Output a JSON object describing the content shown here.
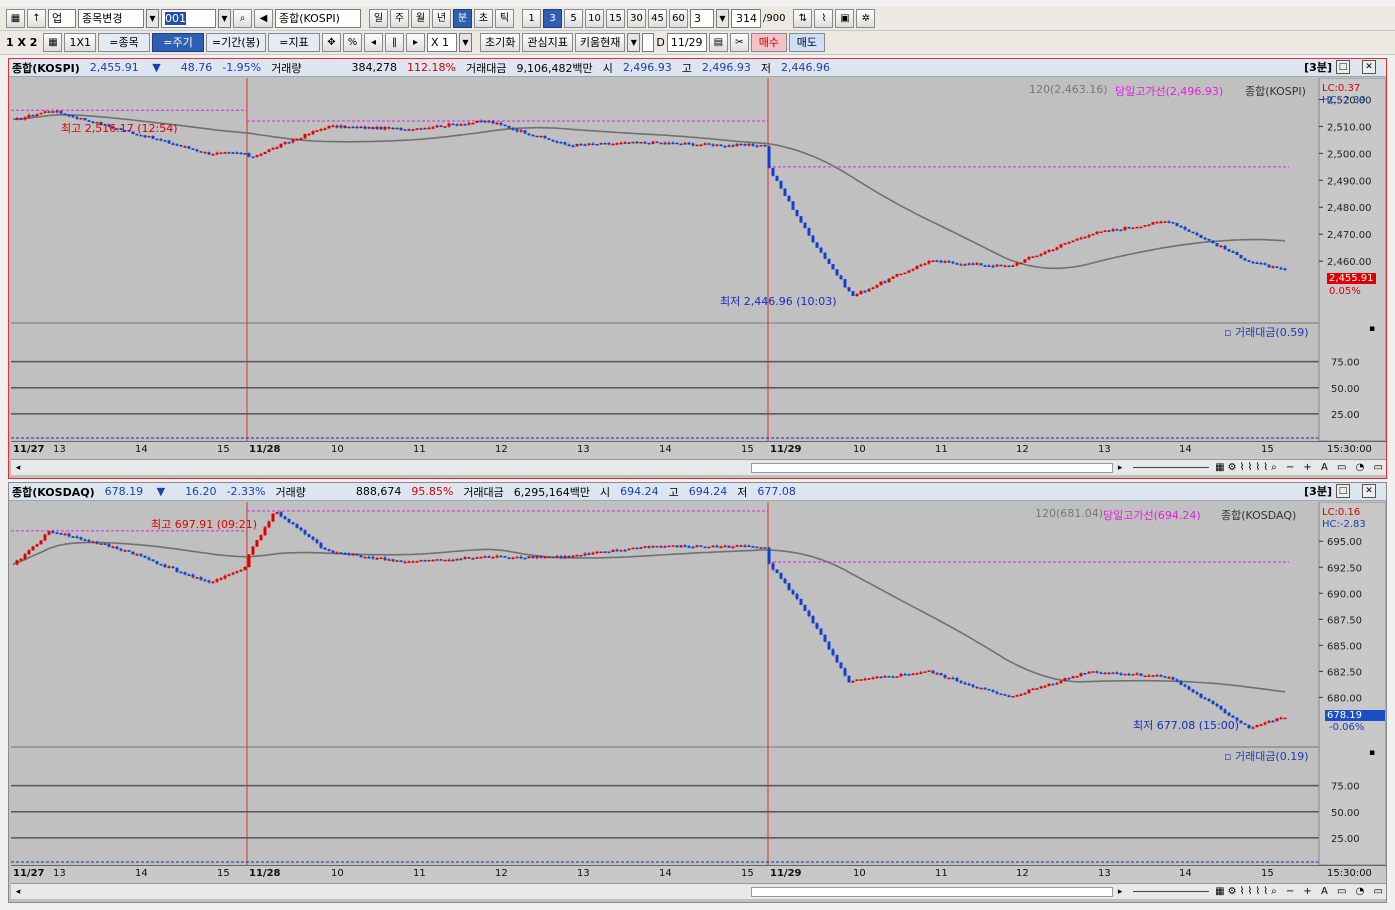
{
  "toolbar1": {
    "market": "업",
    "change_item": "종목변경",
    "code": "001",
    "name": "종합(KOSPI)",
    "period_buttons": [
      "일",
      "주",
      "월",
      "년",
      "분",
      "초",
      "틱"
    ],
    "period_selected": "분",
    "minute_buttons": [
      "1",
      "3",
      "5",
      "10",
      "15",
      "30",
      "45",
      "60"
    ],
    "minute_selected": "3",
    "minute_value": "3",
    "count_value": "314",
    "count_max": "/900"
  },
  "toolbar2": {
    "layout": "1 X 2",
    "one_by_one": "1X1",
    "item_label": "=종목",
    "period_label": "=주기",
    "range_label": "=기간(봉)",
    "indicator_label": "=지표",
    "percent": "%",
    "zoom": "X 1",
    "reset": "초기화",
    "interest": "관심지표",
    "kiwoom": "키움현재",
    "date_prefix": "D",
    "date": "11/29",
    "buy": "매수",
    "sell": "매도"
  },
  "pane1": {
    "name": "종합(KOSPI)",
    "price": "2,455.91",
    "arrow": "▼",
    "change": "48.76",
    "change_pct": "-1.95%",
    "vol_label": "거래량",
    "vol": "384,278",
    "vol_pct": "112.18%",
    "amt_label": "거래대금",
    "amt": "9,106,482백만",
    "open_label": "시",
    "open": "2,496.93",
    "high_label": "고",
    "high": "2,496.93",
    "low_label": "저",
    "low": "2,446.96",
    "period_tag": "[3분]",
    "ma_label": "120(2,463.16)",
    "line_label": "당일고가선(2,496.93)",
    "series_label": "종합(KOSPI)",
    "lc": "LC:0.37",
    "hc": "HC:-2.39",
    "price_box": "2,455.91",
    "price_pct": "0.05%",
    "max_note": "최고 2,516.17 (12:54)",
    "min_note": "최저 2,446.96 (10:03)",
    "sub_label": "거래대금(0.59)",
    "yticks": [
      "2,520.00",
      "2,510.00",
      "2,500.00",
      "2,490.00",
      "2,480.00",
      "2,470.00",
      "2,460.00"
    ],
    "sub_ticks": [
      "75.00",
      "50.00",
      "25.00"
    ],
    "time_label": "15:30:00",
    "xticks": [
      {
        "t": "11/27",
        "d": true
      },
      {
        "t": "13",
        "d": false
      },
      {
        "t": "14",
        "d": false
      },
      {
        "t": "15",
        "d": false
      },
      {
        "t": "11/28",
        "d": true
      },
      {
        "t": "10",
        "d": false
      },
      {
        "t": "11",
        "d": false
      },
      {
        "t": "12",
        "d": false
      },
      {
        "t": "13",
        "d": false
      },
      {
        "t": "14",
        "d": false
      },
      {
        "t": "15",
        "d": false
      },
      {
        "t": "11/29",
        "d": true
      },
      {
        "t": "10",
        "d": false
      },
      {
        "t": "11",
        "d": false
      },
      {
        "t": "12",
        "d": false
      },
      {
        "t": "13",
        "d": false
      },
      {
        "t": "14",
        "d": false
      },
      {
        "t": "15",
        "d": false
      }
    ]
  },
  "pane2": {
    "name": "종합(KOSDAQ)",
    "price": "678.19",
    "arrow": "▼",
    "change": "16.20",
    "change_pct": "-2.33%",
    "vol_label": "거래량",
    "vol": "888,674",
    "vol_pct": "95.85%",
    "amt_label": "거래대금",
    "amt": "6,295,164백만",
    "open_label": "시",
    "open": "694.24",
    "high_label": "고",
    "high": "694.24",
    "low_label": "저",
    "low": "677.08",
    "period_tag": "[3분]",
    "ma_label": "120(681.04)",
    "line_label": "당일고가선(694.24)",
    "series_label": "종합(KOSDAQ)",
    "lc": "LC:0.16",
    "hc": "HC:-2.83",
    "price_box": "678.19",
    "price_pct": "-0.06%",
    "max_note": "최고 697.91 (09:21)",
    "min_note": "최저 677.08 (15:00)",
    "sub_label": "거래대금(0.19)",
    "yticks": [
      "695.00",
      "692.50",
      "690.00",
      "687.50",
      "685.00",
      "682.50",
      "680.00"
    ],
    "sub_ticks": [
      "75.00",
      "50.00",
      "25.00"
    ],
    "time_label": "15:30:00",
    "xticks": [
      {
        "t": "11/27",
        "d": true
      },
      {
        "t": "13",
        "d": false
      },
      {
        "t": "14",
        "d": false
      },
      {
        "t": "15",
        "d": false
      },
      {
        "t": "11/28",
        "d": true
      },
      {
        "t": "10",
        "d": false
      },
      {
        "t": "11",
        "d": false
      },
      {
        "t": "12",
        "d": false
      },
      {
        "t": "13",
        "d": false
      },
      {
        "t": "14",
        "d": false
      },
      {
        "t": "15",
        "d": false
      },
      {
        "t": "11/29",
        "d": true
      },
      {
        "t": "10",
        "d": false
      },
      {
        "t": "11",
        "d": false
      },
      {
        "t": "12",
        "d": false
      },
      {
        "t": "13",
        "d": false
      },
      {
        "t": "14",
        "d": false
      },
      {
        "t": "15",
        "d": false
      }
    ]
  },
  "colors": {
    "up": "#e00000",
    "down": "#1040d0",
    "ma": "#707070",
    "highline": "#e020e0"
  },
  "chart_data": [
    {
      "type": "line",
      "title": "종합(KOSPI)",
      "xlabel": "",
      "ylabel": "",
      "x": [
        "11/27 12:30",
        "11/27 13:00",
        "11/27 14:00",
        "11/27 15:00",
        "11/27 15:30",
        "11/28 09:00",
        "11/28 10:00",
        "11/28 11:00",
        "11/28 12:00",
        "11/28 13:00",
        "11/28 14:00",
        "11/28 15:00",
        "11/28 15:30",
        "11/29 09:00",
        "11/29 09:30",
        "11/29 10:03",
        "11/29 11:00",
        "11/29 12:00",
        "11/29 13:00",
        "11/29 14:00",
        "11/29 15:00",
        "11/29 15:30"
      ],
      "series": [
        {
          "values": [
            2512,
            2516,
            2508,
            2500,
            2500,
            2498,
            2510,
            2509,
            2512,
            2503,
            2504,
            2503,
            2503,
            2495,
            2470,
            2447,
            2460,
            2458,
            2470,
            2475,
            2460,
            2456
          ]
        }
      ],
      "ylim": [
        2440,
        2525
      ]
    },
    {
      "type": "line",
      "title": "종합(KOSDAQ)",
      "xlabel": "",
      "ylabel": "",
      "x": [
        "11/27 12:30",
        "11/27 13:00",
        "11/27 14:00",
        "11/27 15:00",
        "11/27 15:30",
        "11/28 09:00",
        "11/28 09:21",
        "11/28 10:00",
        "11/28 11:00",
        "11/28 12:00",
        "11/28 13:00",
        "11/28 14:00",
        "11/28 15:30",
        "11/29 09:00",
        "11/29 09:30",
        "11/29 10:00",
        "11/29 11:00",
        "11/29 12:00",
        "11/29 13:00",
        "11/29 14:00",
        "11/29 15:00",
        "11/29 15:30"
      ],
      "series": [
        {
          "values": [
            692.5,
            696.0,
            694.0,
            691.0,
            692.5,
            693.5,
            697.9,
            694.0,
            693.0,
            693.5,
            693.5,
            694.5,
            694.5,
            693.0,
            688.0,
            681.5,
            682.5,
            680.0,
            682.5,
            682.0,
            677.1,
            678.2
          ]
        }
      ],
      "ylim": [
        676,
        698
      ]
    }
  ]
}
